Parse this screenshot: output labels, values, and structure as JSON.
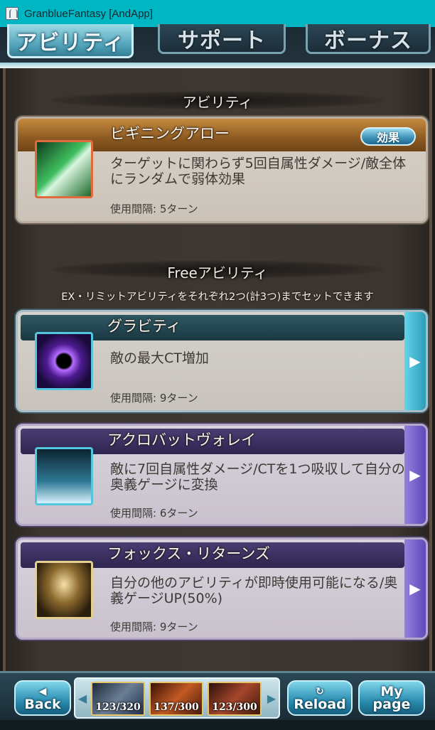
{
  "window": {
    "title": "GranblueFantasy [AndApp]"
  },
  "tabs": [
    {
      "label": "アビリティ",
      "active": true
    },
    {
      "label": "サポート",
      "active": false
    },
    {
      "label": "ボーナス",
      "active": false
    }
  ],
  "sections": {
    "ability": {
      "title": "アビリティ"
    },
    "free": {
      "title": "Freeアビリティ",
      "note": "EX・リミットアビリティをそれぞれ2つ(計3つ)までセットできます"
    }
  },
  "abilities": [
    {
      "name": "ビギニングアロー",
      "description": "ターゲットに関わらず5回自属性ダメージ/敵全体にランダムで弱体効果",
      "interval": "使用間隔: 5ターン",
      "button": "効果",
      "icon": "green-arrow-icon"
    },
    {
      "name": "グラビティ",
      "description": "敵の最大CT増加",
      "interval": "使用間隔: 9ターン",
      "icon": "black-hole-icon"
    },
    {
      "name": "アクロバットヴォレイ",
      "description": "敵に7回自属性ダメージ/CTを1つ吸収して自分の奥義ゲージに変換",
      "interval": "使用間隔: 6ターン",
      "icon": "ice-spikes-icon"
    },
    {
      "name": "フォックス・リターンズ",
      "description": "自分の他のアビリティが即時使用可能になる/奥義ゲージUP(50%)",
      "interval": "使用間隔: 9ターン",
      "icon": "fox-glasses-icon"
    }
  ],
  "bottom": {
    "back": {
      "glyph": "◀",
      "label": "Back"
    },
    "reload": {
      "glyph": "↻",
      "label": "Reload"
    },
    "mypage": {
      "label1": "My",
      "label2": "page"
    },
    "party": [
      {
        "hp": "123/320"
      },
      {
        "hp": "137/300"
      },
      {
        "hp": "123/300"
      }
    ]
  },
  "colors": {
    "titlebar": "#00b6c2",
    "tab_active": "#4e9fb6",
    "lead_card_header": "#8c5a22",
    "gravity_header": "#1a3842",
    "purple_header": "#2e2550"
  }
}
